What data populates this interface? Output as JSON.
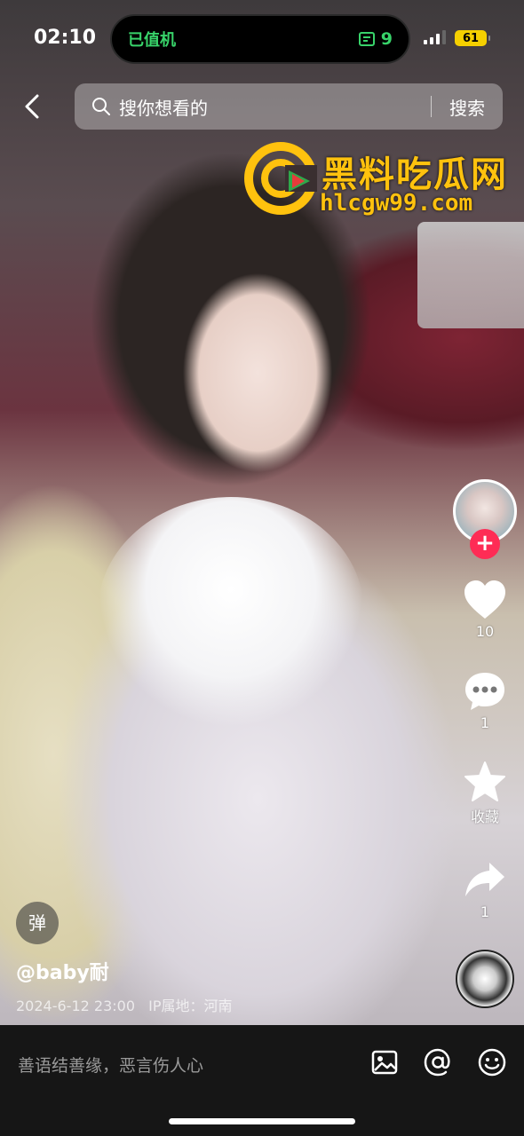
{
  "status_bar": {
    "time": "02:10",
    "island_left": "已值机",
    "island_right_number": "9",
    "battery": "61"
  },
  "search": {
    "placeholder": "搜你想看的",
    "button_label": "搜索"
  },
  "watermark": {
    "title": "黑料吃瓜网",
    "url": "hlcgw99.com"
  },
  "actions": {
    "follow_symbol": "+",
    "like_count": "10",
    "comment_count": "1",
    "favorite_label": "收藏",
    "share_count": "1"
  },
  "video_info": {
    "danmu_toggle": "弹",
    "author": "@baby耐",
    "timestamp": "2024-6-12 23:00",
    "ip_location": "IP属地：河南"
  },
  "comment_bar": {
    "placeholder": "善语结善缘，恶言伤人心"
  },
  "icons": [
    "back-icon",
    "search-icon",
    "heart-icon",
    "comment-icon",
    "star-icon",
    "share-icon",
    "image-icon",
    "at-icon",
    "emoji-icon",
    "boarding-pass-icon"
  ]
}
